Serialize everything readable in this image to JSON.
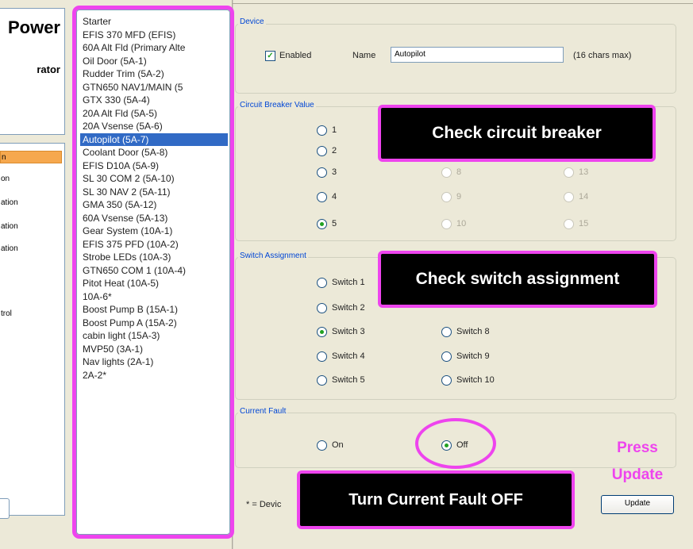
{
  "left_panel": {
    "title": "Power",
    "subtitle": "rator",
    "nav_items": [
      "n",
      "on",
      "ation",
      "ation",
      "ation",
      "",
      "",
      "trol"
    ]
  },
  "device_list": {
    "items": [
      "Starter",
      "EFIS 370 MFD (EFIS)",
      "60A Alt Fld (Primary Alte",
      "Oil Door (5A-1)",
      "Rudder Trim (5A-2)",
      "GTN650 NAV1/MAIN (5",
      "GTX 330 (5A-4)",
      "20A Alt Fld (5A-5)",
      "20A Vsense (5A-6)",
      "Autopilot (5A-7)",
      "Coolant Door (5A-8)",
      "EFIS D10A (5A-9)",
      "SL 30 COM 2 (5A-10)",
      "SL 30 NAV 2 (5A-11)",
      "GMA 350 (5A-12)",
      "60A Vsense (5A-13)",
      "Gear System (10A-1)",
      "EFIS 375 PFD (10A-2)",
      "Strobe LEDs (10A-3)",
      "GTN650 COM 1 (10A-4)",
      "Pitot Heat (10A-5)",
      "10A-6*",
      "Boost Pump B (15A-1)",
      "Boost Pump A (15A-2)",
      "cabin light (15A-3)",
      "MVP50 (3A-1)",
      "Nav lights (2A-1)",
      "2A-2*"
    ],
    "selected_index": 9
  },
  "device_group": {
    "label": "Device",
    "enabled_label": "Enabled",
    "enabled_checked": true,
    "name_label": "Name",
    "name_value": "Autopilot",
    "name_hint": "(16 chars max)"
  },
  "breaker_group": {
    "label": "Circuit Breaker Value",
    "options_col1": [
      "1",
      "2",
      "3",
      "4",
      "5"
    ],
    "options_col2": [
      "8",
      "9",
      "10"
    ],
    "options_col3": [
      "13",
      "14",
      "15"
    ],
    "selected": "5"
  },
  "switch_group": {
    "label": "Switch Assignment",
    "col1": [
      "Switch 1",
      "Switch 2",
      "Switch 3",
      "Switch 4",
      "Switch 5"
    ],
    "col2": [
      "Switch 8",
      "Switch 9",
      "Switch 10"
    ],
    "selected": "Switch 3"
  },
  "fault_group": {
    "label": "Current Fault",
    "on_label": "On",
    "off_label": "Off",
    "selected": "Off"
  },
  "footer": {
    "note": "* = Devic",
    "update_label": "Update"
  },
  "annotations": {
    "check_breaker": "Check circuit breaker",
    "check_switch": "Check switch assignment",
    "turn_fault_off": "Turn Current Fault OFF",
    "press_update_1": "Press",
    "press_update_2": "Update"
  },
  "colors": {
    "highlight": "#ee44ee",
    "selection": "#316ac5",
    "radio_dot": "#21a121"
  }
}
